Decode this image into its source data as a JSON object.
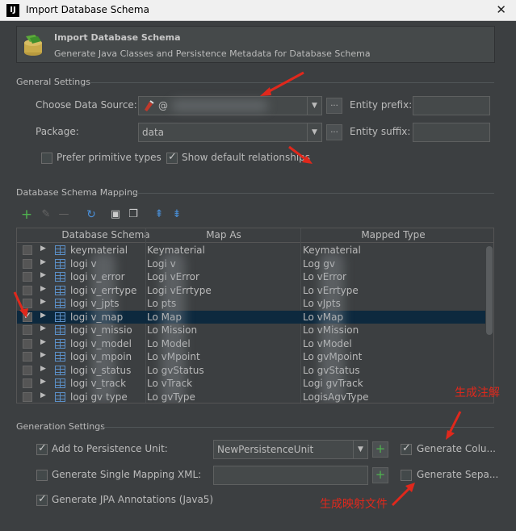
{
  "window": {
    "title": "Import Database Schema",
    "app_icon": "IJ",
    "close_glyph": "✕"
  },
  "header": {
    "title": "Import Database Schema",
    "subtitle": "Generate Java Classes and Persistence Metadata for Database Schema"
  },
  "general": {
    "section_title": "General Settings",
    "data_source_label": "Choose Data Source:",
    "data_source_value": "@",
    "package_label": "Package:",
    "package_value": "data",
    "entity_prefix_label": "Entity prefix:",
    "entity_suffix_label": "Entity suffix:",
    "ellipsis": "...",
    "prefer_primitive": {
      "label": "Prefer primitive types",
      "checked": false
    },
    "show_default_relationships": {
      "label": "Show default relationships",
      "checked": true
    }
  },
  "mapping": {
    "section_title": "Database Schema Mapping",
    "columns": [
      "Database Schema",
      "Map As",
      "Mapped Type"
    ],
    "rows": [
      {
        "schema": "keymaterial",
        "map_as": "Keymaterial",
        "mapped_type": "Keymaterial",
        "checked": false,
        "selected": false
      },
      {
        "schema": "logi     v",
        "map_as": "Logi     v",
        "mapped_type": "Log     gv",
        "checked": false,
        "selected": false
      },
      {
        "schema": "logi     v_error",
        "map_as": "Logi     vError",
        "mapped_type": "Lo     vError",
        "checked": false,
        "selected": false
      },
      {
        "schema": "logi     v_errtype",
        "map_as": "Logi     vErrtype",
        "mapped_type": "Lo     vErrtype",
        "checked": false,
        "selected": false
      },
      {
        "schema": "logi     v_jpts",
        "map_as": "Lo     pts",
        "mapped_type": "Lo     vJpts",
        "checked": false,
        "selected": false
      },
      {
        "schema": "logi     v_map",
        "map_as": "Lo     Map",
        "mapped_type": "Lo     vMap",
        "checked": true,
        "selected": true
      },
      {
        "schema": "logi     v_missio",
        "map_as": "Lo     Mission",
        "mapped_type": "Lo     vMission",
        "checked": false,
        "selected": false
      },
      {
        "schema": "logi     v_model",
        "map_as": "Lo     Model",
        "mapped_type": "Lo     vModel",
        "checked": false,
        "selected": false
      },
      {
        "schema": "logi     v_mpoin",
        "map_as": "Lo     vMpoint",
        "mapped_type": "Lo     gvMpoint",
        "checked": false,
        "selected": false
      },
      {
        "schema": "logi     v_status",
        "map_as": "Lo     gvStatus",
        "mapped_type": "Lo     gvStatus",
        "checked": false,
        "selected": false
      },
      {
        "schema": "logi     v_track",
        "map_as": "Lo     vTrack",
        "mapped_type": "Logi     gvTrack",
        "checked": false,
        "selected": false
      },
      {
        "schema": "logi     gv type",
        "map_as": "Lo     gvType",
        "mapped_type": "LogisAgvType",
        "checked": false,
        "selected": false
      }
    ]
  },
  "generation": {
    "section_title": "Generation Settings",
    "add_to_persistence": {
      "label": "Add to Persistence Unit:",
      "checked": true,
      "value": "NewPersistenceUnit"
    },
    "single_mapping_xml": {
      "label": "Generate Single Mapping XML:",
      "checked": false
    },
    "jpa_annotations": {
      "label": "Generate JPA Annotations (Java5)",
      "checked": true
    },
    "generate_column": {
      "label": "Generate Colu...",
      "checked": true
    },
    "generate_separate": {
      "label": "Generate Sepa...",
      "checked": false
    },
    "plus_glyph": "+"
  },
  "annotations": {
    "generate_comments": "生成注解",
    "generate_mapping_files": "生成映射文件"
  },
  "colors": {
    "accent_red": "#e0281c",
    "selection": "#0d293e",
    "background": "#3c3f41"
  }
}
